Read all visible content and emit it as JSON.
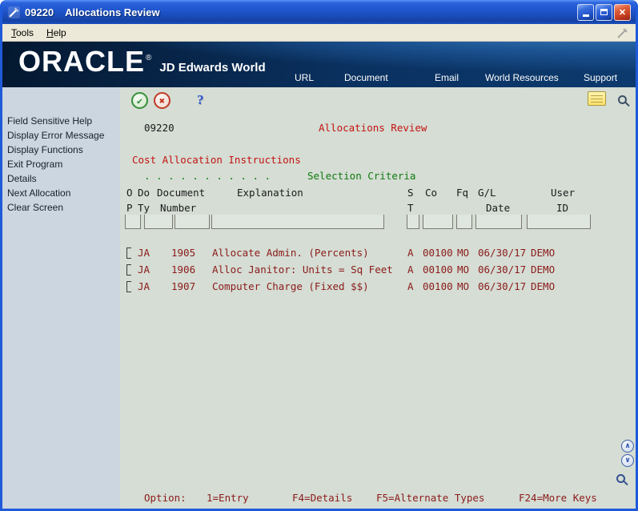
{
  "window": {
    "title": "09220    Allocations Review"
  },
  "icons": {
    "close": "✕",
    "check": "✔",
    "cancel": "✖",
    "help": "?",
    "chevron_up": "∧",
    "chevron_down": "∨"
  },
  "colors": {
    "title_red": "#c41212",
    "data_maroon": "#8b1a1a",
    "criteria_green": "#0f7a0f",
    "banner_navy": "#0a3160",
    "sidebar_blue": "#cbd6e0",
    "screen_gray_green": "#d5ddd4"
  },
  "menubar": {
    "items": [
      "Tools",
      "Help"
    ]
  },
  "banner": {
    "brand": "ORACLE",
    "registered": "®",
    "product": "JD Edwards World",
    "links": [
      "URL",
      "Document",
      "Email",
      "World Resources",
      "Support"
    ]
  },
  "sidebar": {
    "items": [
      "Field Sensitive Help",
      "Display Error Message",
      "Display Functions",
      "Exit Program",
      "Details",
      "Next Allocation",
      "Clear Screen"
    ]
  },
  "screen": {
    "program_code": "09220",
    "title": "Allocations Review",
    "section": "Cost Allocation Instructions",
    "dots": ". . . . . . . . . . .",
    "selection": "Selection Criteria",
    "headers": {
      "op_1": "O",
      "op_2": "P",
      "doty_1": "Do",
      "doty_2": "Ty",
      "doc_1": "Document",
      "doc_2": "Number",
      "explanation": "Explanation",
      "st_1": "S",
      "st_2": "T",
      "co": "Co",
      "fq": "Fq",
      "gl_1": "G/L",
      "gl_2": "Date",
      "user_1": "User",
      "user_2": "ID"
    },
    "rows": [
      {
        "ty": "JA",
        "number": "1905",
        "explanation": "Allocate Admin. (Percents)",
        "s": "A",
        "co": "00100",
        "fq": "MO",
        "date": "06/30/17",
        "user": "DEMO"
      },
      {
        "ty": "JA",
        "number": "1906",
        "explanation": "Alloc Janitor: Units = Sq Feet",
        "s": "A",
        "co": "00100",
        "fq": "MO",
        "date": "06/30/17",
        "user": "DEMO"
      },
      {
        "ty": "JA",
        "number": "1907",
        "explanation": "Computer Charge (Fixed $$)",
        "s": "A",
        "co": "00100",
        "fq": "MO",
        "date": "06/30/17",
        "user": "DEMO"
      }
    ],
    "footer": {
      "label": "Option:",
      "key1": "1=Entry",
      "key2": "F4=Details",
      "key3": "F5=Alternate Types",
      "key4": "F24=More Keys"
    }
  }
}
